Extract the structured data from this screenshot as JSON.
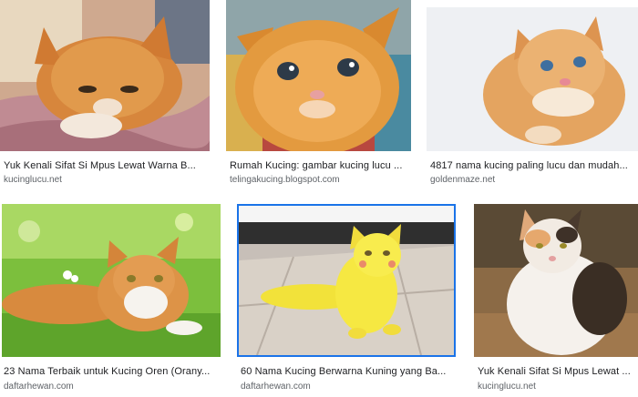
{
  "results": [
    {
      "title": "Yuk Kenali Sifat Si Mpus Lewat Warna B...",
      "source": "kucinglucu.net",
      "image_icon": "orange-tabby-cat-on-bed-image"
    },
    {
      "title": "Rumah Kucing: gambar kucing lucu ...",
      "source": "telingakucing.blogspot.com",
      "image_icon": "orange-kitten-closeup-image"
    },
    {
      "title": "4817 nama kucing paling lucu dan mudah...",
      "source": "goldenmaze.net",
      "image_icon": "fluffy-persian-kitten-image"
    },
    {
      "title": "23 Nama Terbaik untuk Kucing Oren (Orany...",
      "source": "daftarhewan.com",
      "image_icon": "orange-white-cat-on-grass-image"
    },
    {
      "title": "60 Nama Kucing Berwarna Kuning yang Ba...",
      "source": "daftarhewan.com",
      "image_icon": "yellow-cat-on-tiles-image"
    },
    {
      "title": "Yuk Kenali Sifat Si Mpus Lewat ...",
      "source": "kucinglucu.net",
      "image_icon": "calico-cat-outdoors-image"
    }
  ],
  "colors": {
    "selected_border": "#1a73e8",
    "title_text": "#202124",
    "source_text": "#5f6368"
  }
}
